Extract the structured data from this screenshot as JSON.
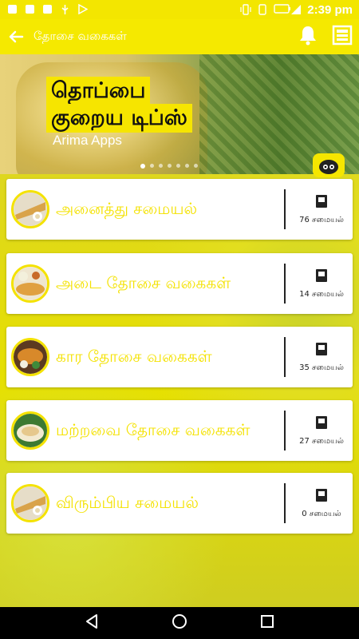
{
  "status_bar": {
    "time": "2:39 pm",
    "icons": [
      "app-icon",
      "app-icon",
      "app-icon",
      "usb-icon",
      "play-icon",
      "vibrate-icon",
      "phone-icon",
      "battery-icon",
      "signal-icon"
    ]
  },
  "app_bar": {
    "title": "தோசை வகைகள்",
    "icons": [
      "back-arrow-icon",
      "bell-icon",
      "layout-icon"
    ]
  },
  "banner": {
    "title_line1": "தொப்பை",
    "title_line2": "குறைய டிப்ஸ்",
    "subtitle": "Arima Apps",
    "page_count": 7,
    "active_page": 0
  },
  "categories": [
    {
      "label": "அனைத்து சமையல்",
      "count": "76 சமையல்"
    },
    {
      "label": "அடை தோசை வகைகள்",
      "count": "14 சமையல்"
    },
    {
      "label": "கார தோசை வகைகள்",
      "count": "35 சமையல்"
    },
    {
      "label": "மற்றவை தோசை வகைகள்",
      "count": "27 சமையல்"
    },
    {
      "label": "விரும்பிய சமையல்",
      "count": "0 சமையல்"
    }
  ],
  "colors": {
    "accent": "#F4E200",
    "status_bar": "#F3E600",
    "nav_bar": "#000000"
  }
}
